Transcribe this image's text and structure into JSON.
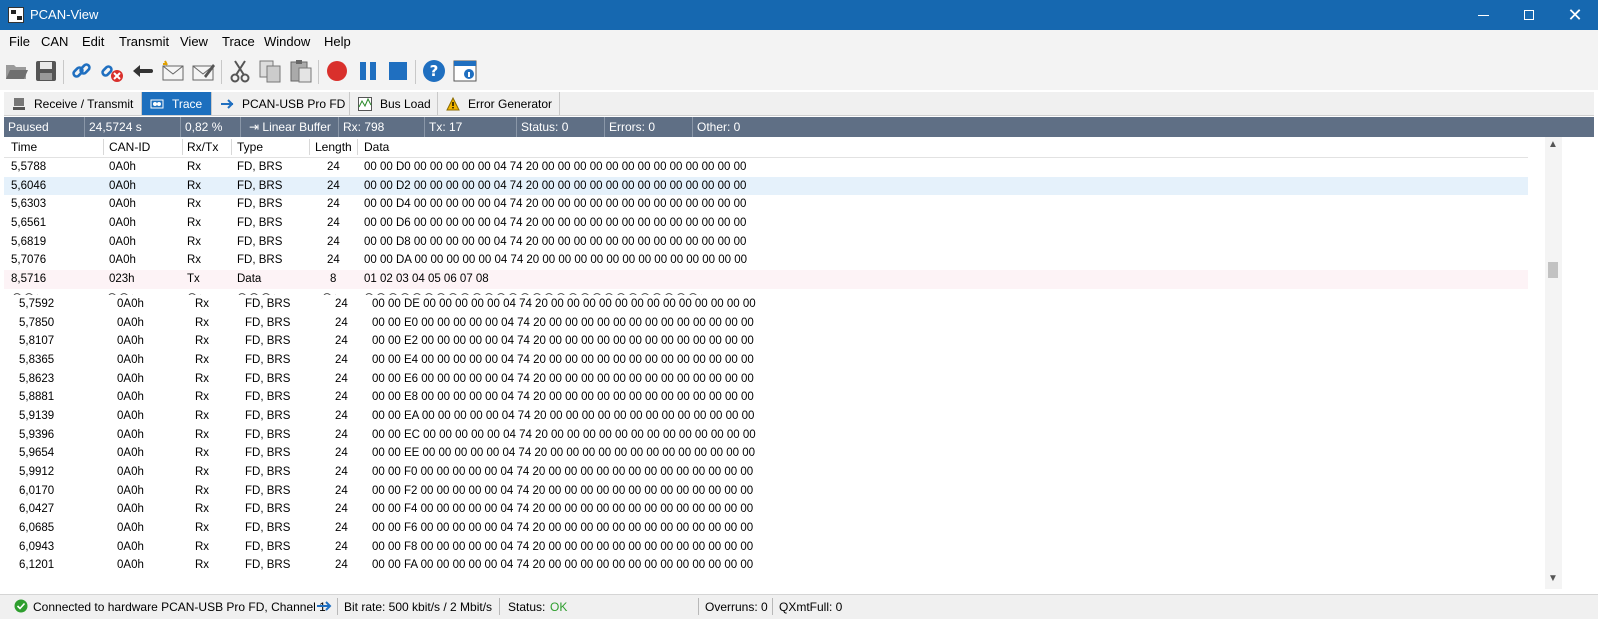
{
  "window": {
    "title": "PCAN-View"
  },
  "menu": [
    "File",
    "CAN",
    "Edit",
    "Transmit",
    "View",
    "Trace",
    "Window",
    "Help"
  ],
  "toolbar": {
    "icons": [
      "open-folder-icon",
      "save-icon",
      "connect-icon",
      "disconnect-icon",
      "reset-icon",
      "new-message-icon",
      "edit-message-icon",
      "cut-icon",
      "copy-icon",
      "paste-icon",
      "record-icon",
      "pause-icon",
      "stop-icon",
      "help-icon",
      "info-icon"
    ],
    "colors": {
      "record": "#d9302c",
      "pause": "#1f6fc0",
      "stop": "#1f6fc0",
      "help": "#1f6fc0"
    }
  },
  "tabs": [
    {
      "label": "Receive / Transmit",
      "icon": "computer-icon"
    },
    {
      "label": "Trace",
      "icon": "trace-icon",
      "active": true
    },
    {
      "label": "PCAN-USB Pro FD",
      "icon": "usb-icon"
    },
    {
      "label": "Bus Load",
      "icon": "bus-load-icon"
    },
    {
      "label": "Error Generator",
      "icon": "warning-icon"
    }
  ],
  "status_strip": {
    "state": "Paused",
    "time": "24,5724 s",
    "percent": "0,82 %",
    "buffer": "Linear Buffer",
    "rx": "Rx: 798",
    "tx": "Tx: 17",
    "status": "Status: 0",
    "errors": "Errors: 0",
    "other": "Other: 0"
  },
  "columns": [
    "Time",
    "CAN-ID",
    "Rx/Tx",
    "Type",
    "Length",
    "Data"
  ],
  "rows_top": [
    {
      "time": "5,5788",
      "id": "0A0h",
      "dir": "Rx",
      "type": "FD, BRS",
      "len": "24",
      "data": "00 00 D0 00 00 00 00 00 04 74 20 00 00 00 00 00 00 00 00 00 00 00 00 00"
    },
    {
      "time": "5,6046",
      "id": "0A0h",
      "dir": "Rx",
      "type": "FD, BRS",
      "len": "24",
      "data": "00 00 D2 00 00 00 00 00 04 74 20 00 00 00 00 00 00 00 00 00 00 00 00 00"
    },
    {
      "time": "5,6303",
      "id": "0A0h",
      "dir": "Rx",
      "type": "FD, BRS",
      "len": "24",
      "data": "00 00 D4 00 00 00 00 00 04 74 20 00 00 00 00 00 00 00 00 00 00 00 00 00"
    },
    {
      "time": "5,6561",
      "id": "0A0h",
      "dir": "Rx",
      "type": "FD, BRS",
      "len": "24",
      "data": "00 00 D6 00 00 00 00 00 04 74 20 00 00 00 00 00 00 00 00 00 00 00 00 00"
    },
    {
      "time": "5,6819",
      "id": "0A0h",
      "dir": "Rx",
      "type": "FD, BRS",
      "len": "24",
      "data": "00 00 D8 00 00 00 00 00 04 74 20 00 00 00 00 00 00 00 00 00 00 00 00 00"
    },
    {
      "time": "5,7076",
      "id": "0A0h",
      "dir": "Rx",
      "type": "FD, BRS",
      "len": "24",
      "data": "00 00 DA 00 00 00 00 00 04 74 20 00 00 00 00 00 00 00 00 00 00 00 00 00"
    },
    {
      "time": "8,5716",
      "id": "023h",
      "dir": "Tx",
      "type": "Data",
      "len": "8",
      "data": "01 02 03 04 05 06 07 08"
    }
  ],
  "rows_bottom": [
    {
      "time": "5,7592",
      "id": "0A0h",
      "dir": "Rx",
      "type": "FD, BRS",
      "len": "24",
      "data": "00 00 DE 00 00 00 00 00 04 74 20 00 00 00 00 00 00 00 00 00 00 00 00 00"
    },
    {
      "time": "5,7850",
      "id": "0A0h",
      "dir": "Rx",
      "type": "FD, BRS",
      "len": "24",
      "data": "00 00 E0 00 00 00 00 00 04 74 20 00 00 00 00 00 00 00 00 00 00 00 00 00"
    },
    {
      "time": "5,8107",
      "id": "0A0h",
      "dir": "Rx",
      "type": "FD, BRS",
      "len": "24",
      "data": "00 00 E2 00 00 00 00 00 04 74 20 00 00 00 00 00 00 00 00 00 00 00 00 00"
    },
    {
      "time": "5,8365",
      "id": "0A0h",
      "dir": "Rx",
      "type": "FD, BRS",
      "len": "24",
      "data": "00 00 E4 00 00 00 00 00 04 74 20 00 00 00 00 00 00 00 00 00 00 00 00 00"
    },
    {
      "time": "5,8623",
      "id": "0A0h",
      "dir": "Rx",
      "type": "FD, BRS",
      "len": "24",
      "data": "00 00 E6 00 00 00 00 00 04 74 20 00 00 00 00 00 00 00 00 00 00 00 00 00"
    },
    {
      "time": "5,8881",
      "id": "0A0h",
      "dir": "Rx",
      "type": "FD, BRS",
      "len": "24",
      "data": "00 00 E8 00 00 00 00 00 04 74 20 00 00 00 00 00 00 00 00 00 00 00 00 00"
    },
    {
      "time": "5,9139",
      "id": "0A0h",
      "dir": "Rx",
      "type": "FD, BRS",
      "len": "24",
      "data": "00 00 EA 00 00 00 00 00 04 74 20 00 00 00 00 00 00 00 00 00 00 00 00 00"
    },
    {
      "time": "5,9396",
      "id": "0A0h",
      "dir": "Rx",
      "type": "FD, BRS",
      "len": "24",
      "data": "00 00 EC 00 00 00 00 00 04 74 20 00 00 00 00 00 00 00 00 00 00 00 00 00"
    },
    {
      "time": "5,9654",
      "id": "0A0h",
      "dir": "Rx",
      "type": "FD, BRS",
      "len": "24",
      "data": "00 00 EE 00 00 00 00 00 04 74 20 00 00 00 00 00 00 00 00 00 00 00 00 00"
    },
    {
      "time": "5,9912",
      "id": "0A0h",
      "dir": "Rx",
      "type": "FD, BRS",
      "len": "24",
      "data": "00 00 F0 00 00 00 00 00 04 74 20 00 00 00 00 00 00 00 00 00 00 00 00 00"
    },
    {
      "time": "6,0170",
      "id": "0A0h",
      "dir": "Rx",
      "type": "FD, BRS",
      "len": "24",
      "data": "00 00 F2 00 00 00 00 00 04 74 20 00 00 00 00 00 00 00 00 00 00 00 00 00"
    },
    {
      "time": "6,0427",
      "id": "0A0h",
      "dir": "Rx",
      "type": "FD, BRS",
      "len": "24",
      "data": "00 00 F4 00 00 00 00 00 04 74 20 00 00 00 00 00 00 00 00 00 00 00 00 00"
    },
    {
      "time": "6,0685",
      "id": "0A0h",
      "dir": "Rx",
      "type": "FD, BRS",
      "len": "24",
      "data": "00 00 F6 00 00 00 00 00 04 74 20 00 00 00 00 00 00 00 00 00 00 00 00 00"
    },
    {
      "time": "6,0943",
      "id": "0A0h",
      "dir": "Rx",
      "type": "FD, BRS",
      "len": "24",
      "data": "00 00 F8 00 00 00 00 00 04 74 20 00 00 00 00 00 00 00 00 00 00 00 00 00"
    },
    {
      "time": "6,1201",
      "id": "0A0h",
      "dir": "Rx",
      "type": "FD, BRS",
      "len": "24",
      "data": "00 00 FA 00 00 00 00 00 04 74 20 00 00 00 00 00 00 00 00 00 00 00 00 00"
    }
  ],
  "bottom_status": {
    "connection": "Connected to hardware PCAN-USB Pro FD, Channel 1",
    "bitrate": "Bit rate: 500 kbit/s / 2 Mbit/s",
    "status_label": "Status:",
    "status_value": "OK",
    "status_color": "#2e9e2e",
    "overruns": "Overruns: 0",
    "qxmtfull": "QXmtFull: 0"
  }
}
